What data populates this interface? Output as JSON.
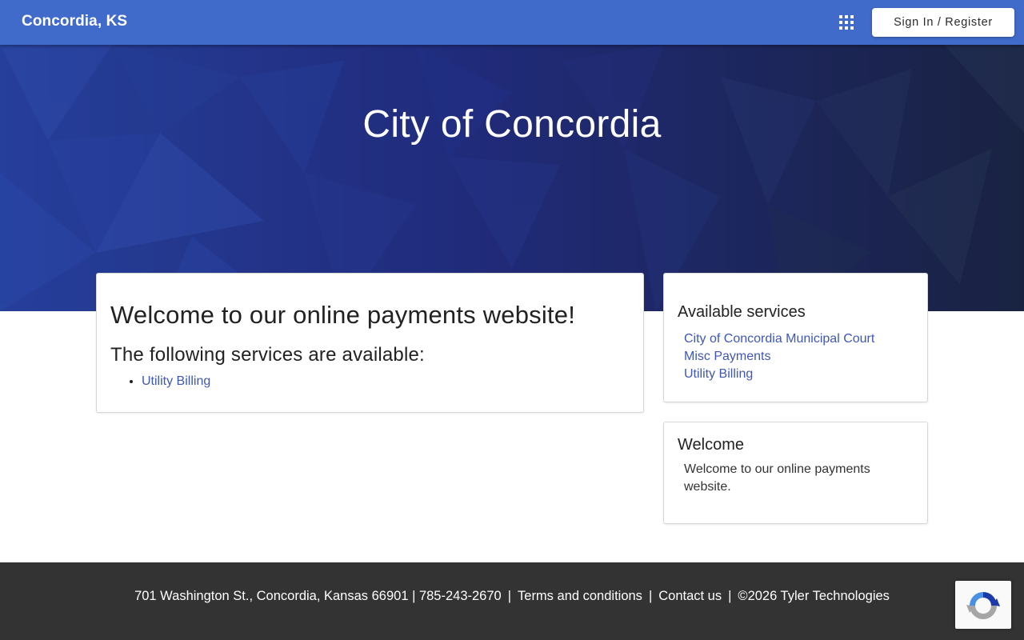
{
  "header": {
    "brand": "Concordia, KS",
    "apps_icon": "apps-grid-icon",
    "signin_label": "Sign In / Register"
  },
  "hero": {
    "title": "City of Concordia"
  },
  "main_card": {
    "heading": "Welcome to our online payments website!",
    "subheading": "The following services are available:",
    "services": [
      "Utility Billing"
    ]
  },
  "services_card": {
    "title": "Available services",
    "items": [
      "City of Concordia Municipal Court",
      "Misc Payments",
      "Utility Billing"
    ]
  },
  "welcome_card": {
    "title": "Welcome",
    "text": "Welcome to our online payments website."
  },
  "footer": {
    "address": "701 Washington St., Concordia, Kansas 66901 | 785-243-2670",
    "separator": "|",
    "terms": "Terms and conditions",
    "contact": "Contact us",
    "copyright": "©2026 Tyler Technologies"
  },
  "recaptcha": {
    "icon": "recaptcha-icon"
  },
  "colors": {
    "header_bg": "#416bcb",
    "hero_bg": "#1f2c7a",
    "link": "#3f57b5",
    "footer_bg": "#333333"
  }
}
